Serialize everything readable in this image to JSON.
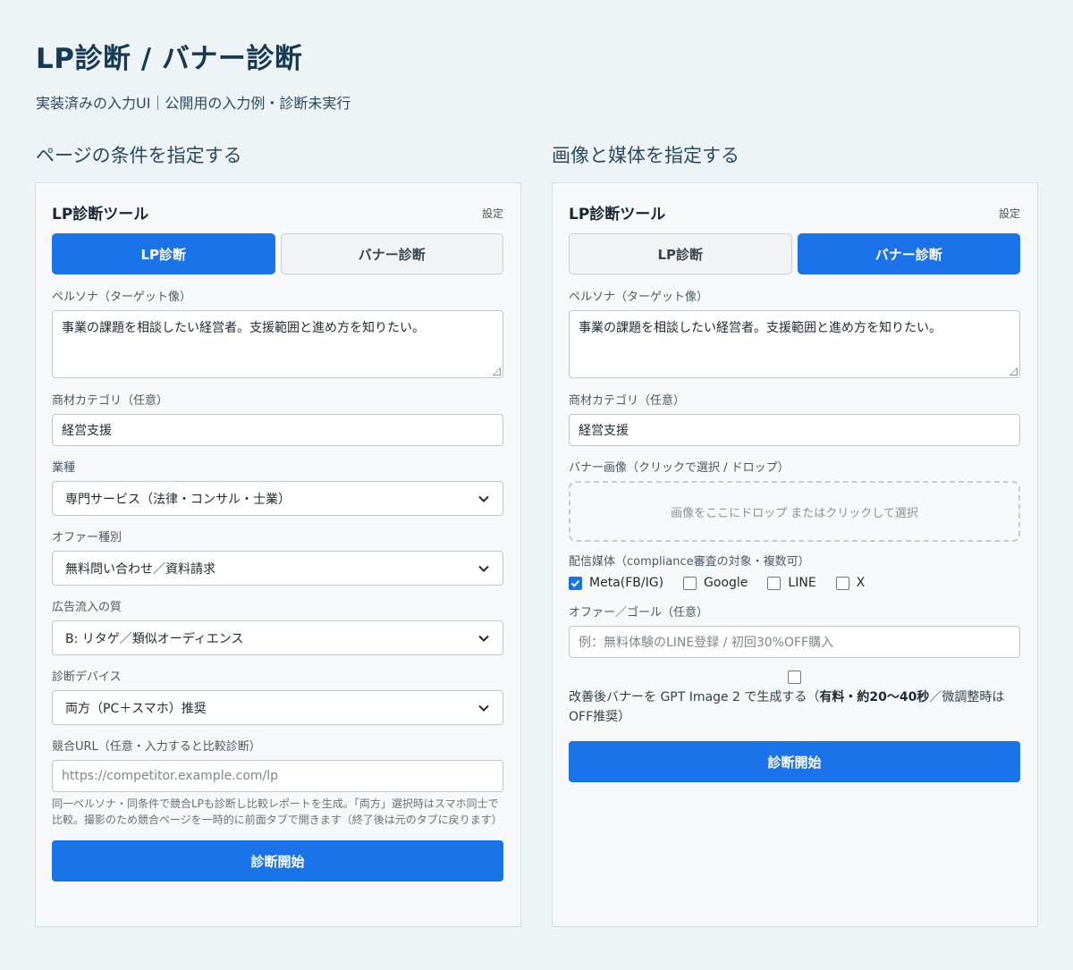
{
  "page": {
    "title": "LP診断 / バナー診断",
    "subtitle": "実装済みの入力UI｜公開用の入力例・診断未実行"
  },
  "left": {
    "section_heading": "ページの条件を指定する",
    "tool_title": "LP診断ツール",
    "settings": "設定",
    "tabs": [
      {
        "label": "LP診断",
        "active": true
      },
      {
        "label": "バナー診断",
        "active": false
      }
    ],
    "persona_label": "ペルソナ（ターゲット像）",
    "persona_value": "事業の課題を相談したい経営者。支援範囲と進め方を知りたい。",
    "category_label": "商材カテゴリ（任意）",
    "category_value": "経営支援",
    "industry_label": "業種",
    "industry_value": "専門サービス（法律・コンサル・士業）",
    "offer_label": "オファー種別",
    "offer_value": "無料問い合わせ／資料請求",
    "traffic_label": "広告流入の質",
    "traffic_value": "B: リタゲ／類似オーディエンス",
    "device_label": "診断デバイス",
    "device_value": "両方（PC＋スマホ）推奨",
    "competitor_label": "競合URL（任意・入力すると比較診断）",
    "competitor_placeholder": "https://competitor.example.com/lp",
    "competitor_help": "同一ペルソナ・同条件で競合LPも診断し比較レポートを生成。「両方」選択時はスマホ同士で比較。撮影のため競合ページを一時的に前面タブで開きます（終了後は元のタブに戻ります）",
    "start_button": "診断開始"
  },
  "right": {
    "section_heading": "画像と媒体を指定する",
    "tool_title": "LP診断ツール",
    "settings": "設定",
    "tabs": [
      {
        "label": "LP診断",
        "active": false
      },
      {
        "label": "バナー診断",
        "active": true
      }
    ],
    "persona_label": "ペルソナ（ターゲット像）",
    "persona_value": "事業の課題を相談したい経営者。支援範囲と進め方を知りたい。",
    "category_label": "商材カテゴリ（任意）",
    "category_value": "経営支援",
    "banner_label": "バナー画像（クリックで選択 / ドロップ）",
    "dropzone_text": "画像をここにドロップ またはクリックして選択",
    "media_label": "配信媒体（compliance審査の対象・複数可）",
    "media_options": [
      {
        "label": "Meta(FB/IG)",
        "checked": true
      },
      {
        "label": "Google",
        "checked": false
      },
      {
        "label": "LINE",
        "checked": false
      },
      {
        "label": "X",
        "checked": false
      }
    ],
    "offer_goal_label": "オファー／ゴール（任意）",
    "offer_goal_placeholder": "例：無料体験のLINE登録 / 初回30%OFF購入",
    "gpt_text_before": "改善後バナーを GPT Image 2 で生成する（",
    "gpt_text_bold": "有料・約20〜40秒",
    "gpt_text_after": "／微調整時はOFF推奨）",
    "start_button": "診断開始"
  },
  "colors": {
    "accent": "#1a73e8",
    "background": "#eef4f6",
    "title": "#173a54"
  }
}
